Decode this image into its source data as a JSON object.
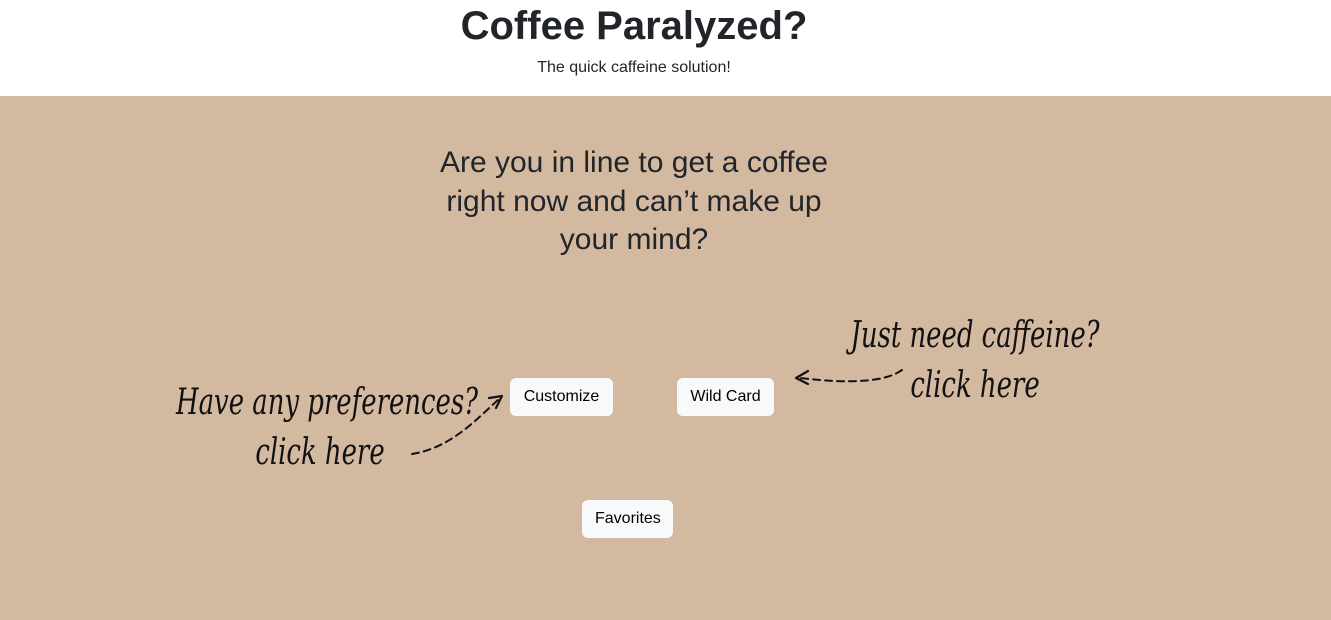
{
  "header": {
    "title": "Coffee Paralyzed?",
    "subtitle": "The quick caffeine solution!"
  },
  "main": {
    "question": "Are you in line to get a coffee right now and can’t make up your mind?",
    "buttons": {
      "customize": "Customize",
      "wild_card": "Wild Card",
      "favorites": "Favorites"
    },
    "notes": {
      "left_line1": "Have any preferences?",
      "left_line2": "click here",
      "right_line1": "Just need caffeine?",
      "right_line2": "click here"
    }
  },
  "colors": {
    "header_bg": "#ffffff",
    "main_bg": "#d4b9a1",
    "button_bg": "#f8f9fa",
    "text": "#212529"
  },
  "icons": [
    "dashed-arrow-icon"
  ]
}
